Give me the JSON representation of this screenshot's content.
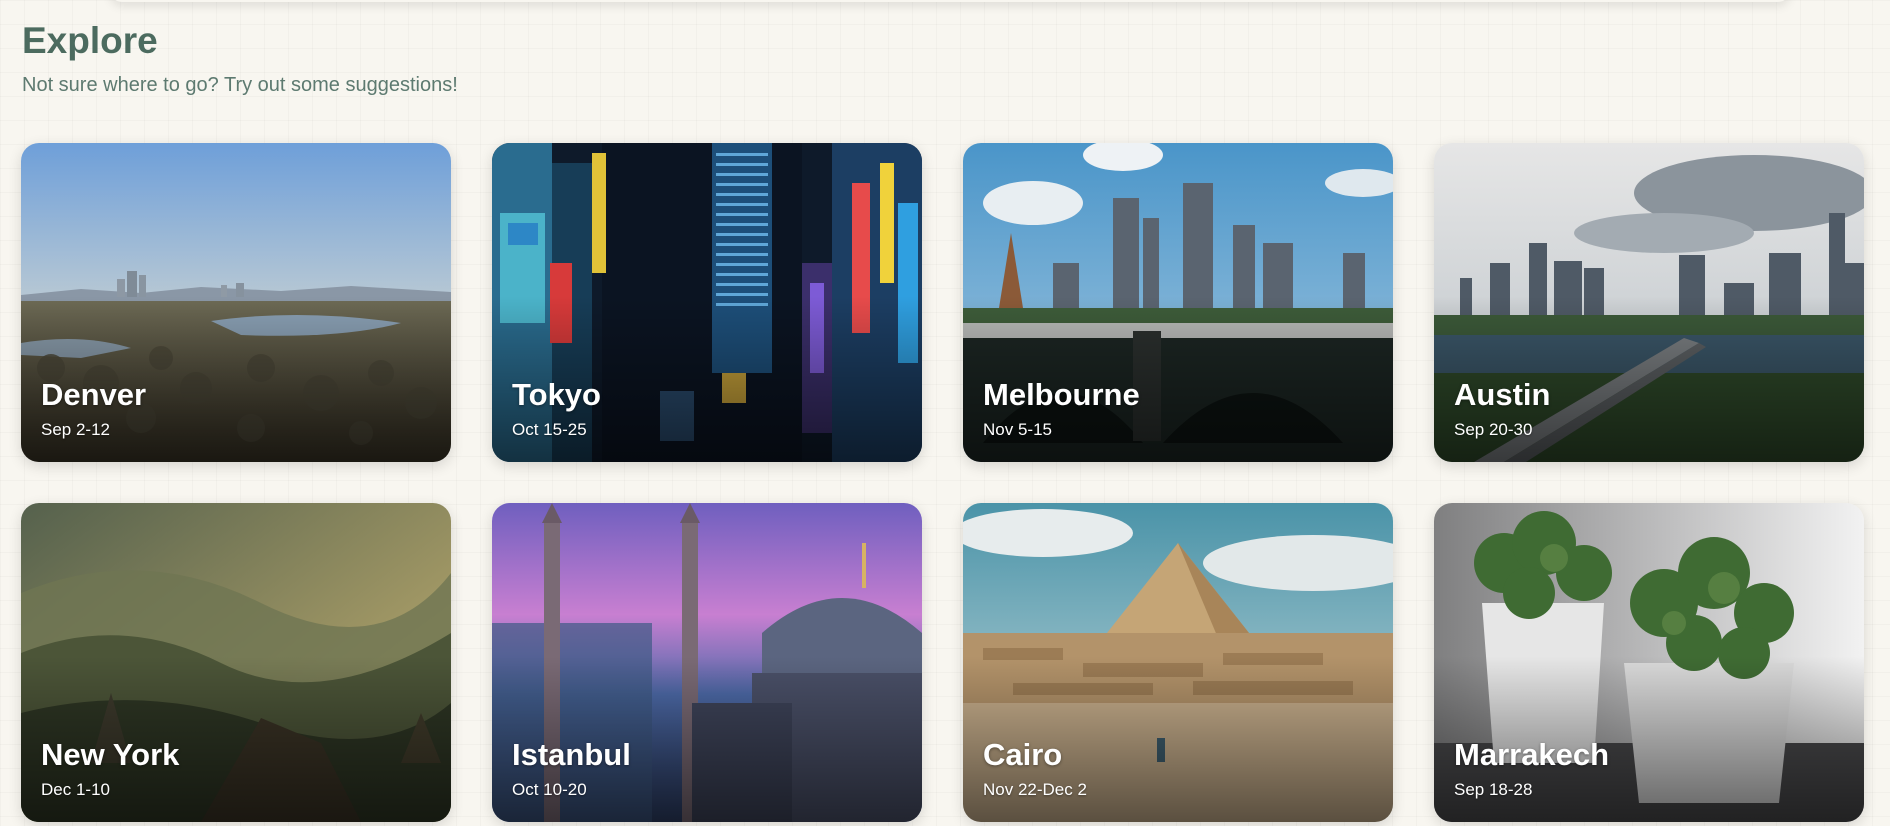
{
  "header": {
    "title": "Explore",
    "subtitle": "Not sure where to go? Try out some suggestions!"
  },
  "destinations": [
    {
      "name": "Denver",
      "dates": "Sep 2-12"
    },
    {
      "name": "Tokyo",
      "dates": "Oct 15-25"
    },
    {
      "name": "Melbourne",
      "dates": "Nov 5-15"
    },
    {
      "name": "Austin",
      "dates": "Sep 20-30"
    },
    {
      "name": "New York",
      "dates": "Dec 1-10"
    },
    {
      "name": "Istanbul",
      "dates": "Oct 10-20"
    },
    {
      "name": "Cairo",
      "dates": "Nov 22-Dec 2"
    },
    {
      "name": "Marrakech",
      "dates": "Sep 18-28"
    }
  ]
}
